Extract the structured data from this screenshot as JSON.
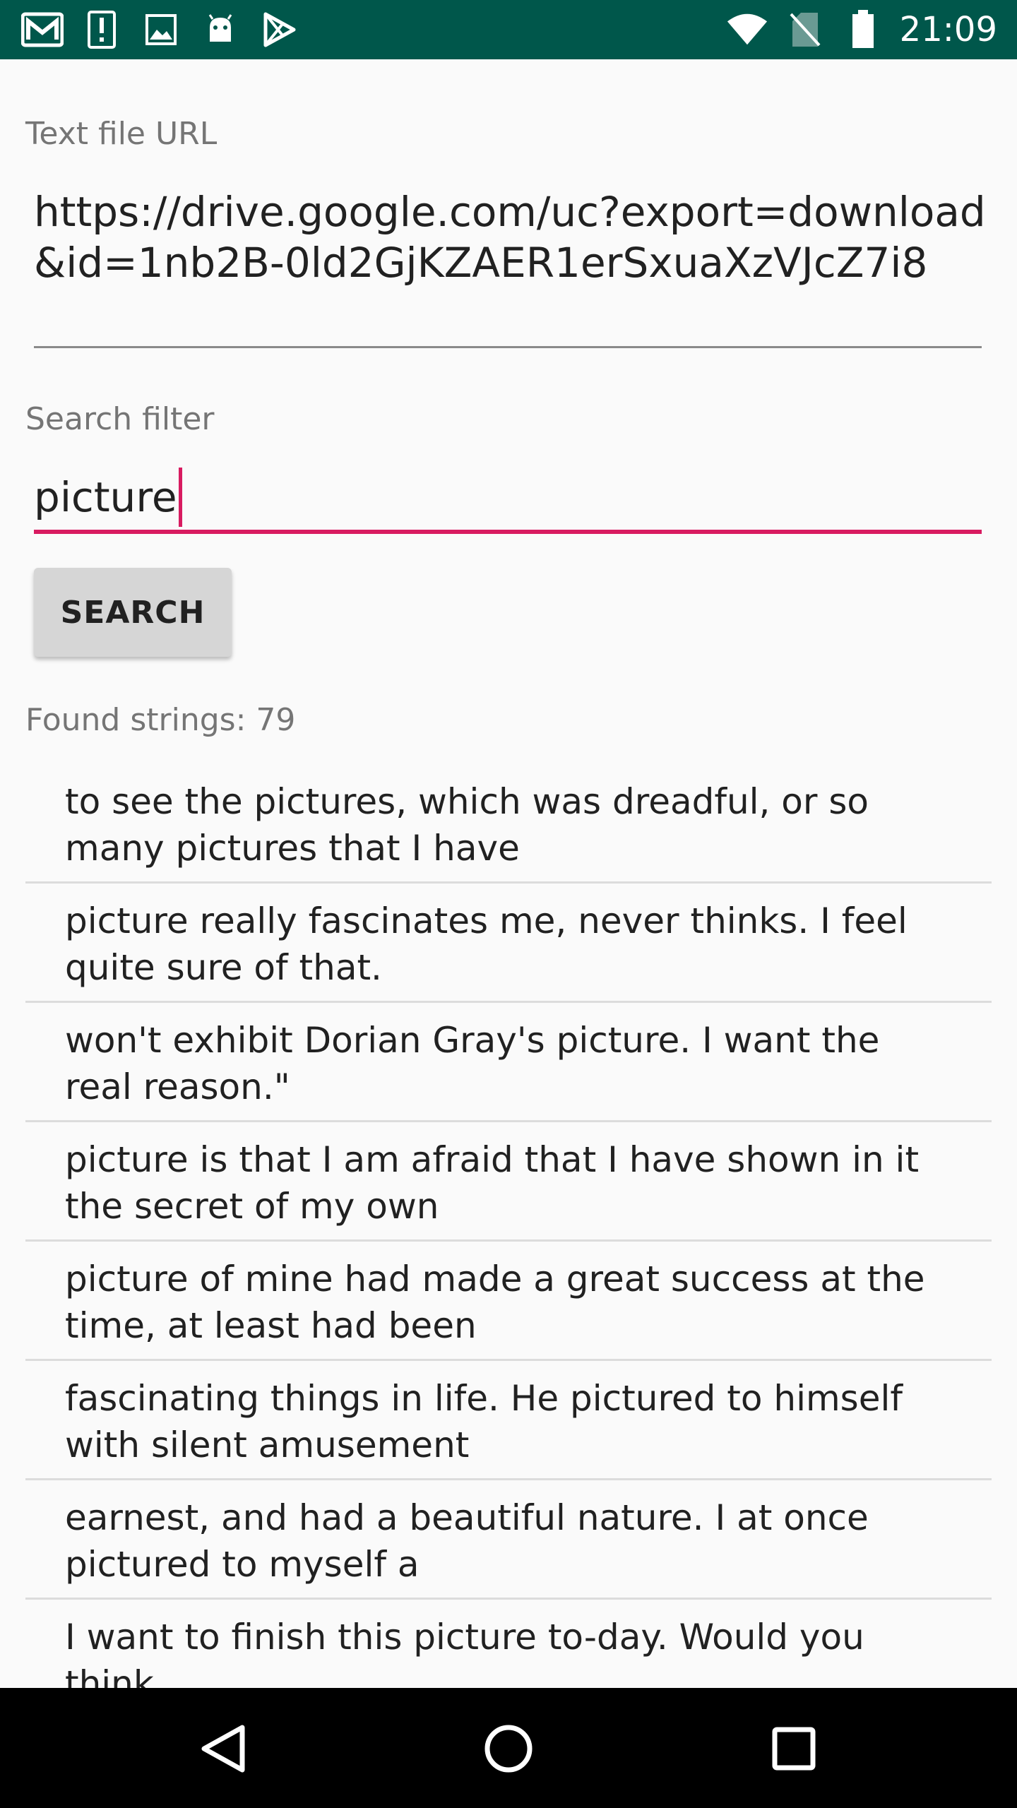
{
  "status_bar": {
    "time": "21:09",
    "left_icons": [
      "gmail-icon",
      "alert-icon",
      "image-icon",
      "android-icon",
      "play-store-icon"
    ],
    "right_icons": [
      "wifi-icon",
      "no-sim-icon",
      "battery-icon"
    ]
  },
  "form": {
    "url_label": "Text file URL",
    "url_value": "https://drive.google.com/uc?export=download&id=1nb2B-0ld2GjKZAER1erSxuaXzVJcZ7i8",
    "filter_label": "Search filter",
    "filter_value": "picture",
    "search_button_label": "SEARCH"
  },
  "results": {
    "found_label": "Found strings: 79",
    "items": [
      "to see the pictures, which was dreadful, or so many pictures that I have",
      "picture really fascinates me, never thinks. I feel quite sure of that.",
      "won't exhibit Dorian Gray's picture. I want the real reason.\"",
      "picture is that I am afraid that I have shown in it the secret of my own",
      "picture of mine had made a great success at the time, at least had been",
      "fascinating things in life. He pictured to himself with silent amusement",
      "earnest, and had a beautiful nature. I at once pictured to myself a",
      "I want to finish this picture to-day. Would you think"
    ]
  },
  "colors": {
    "status_bar": "#00574b",
    "accent": "#d81b60",
    "background": "#fafafa",
    "button": "#d6d6d6"
  },
  "nav_bar": {
    "icons": [
      "back-icon",
      "home-icon",
      "recents-icon"
    ]
  }
}
